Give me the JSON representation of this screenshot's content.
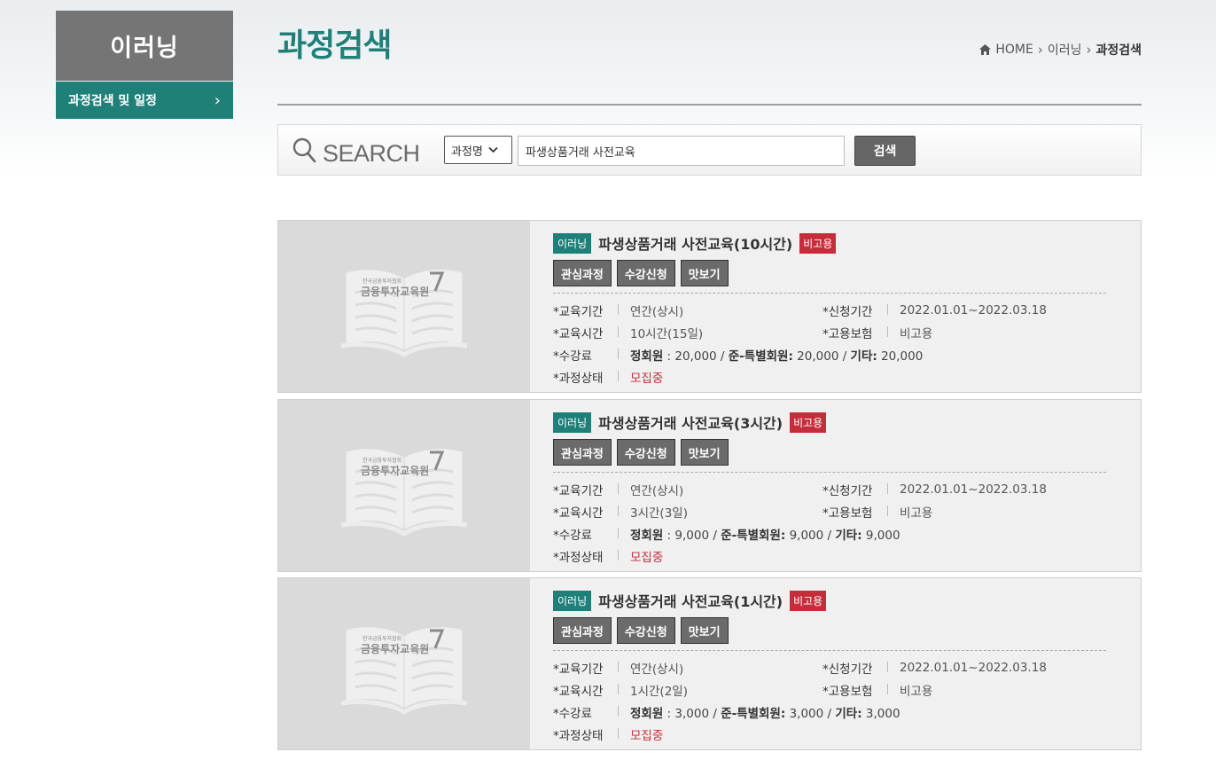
{
  "sidebar": {
    "title": "이러닝",
    "items": [
      {
        "label": "과정검색 및 일정"
      }
    ]
  },
  "header": {
    "title": "과정검색",
    "breadcrumb": [
      "HOME",
      "이러닝",
      "과정검색"
    ]
  },
  "search": {
    "label": "SEARCH",
    "select_value": "과정명",
    "query": "파생상품거래 사전교육",
    "button": "검색"
  },
  "labels": {
    "period": "교육기간",
    "apply": "신청기간",
    "hours": "교육시간",
    "insurance": "고용보험",
    "fee": "수강료",
    "status": "과정상태",
    "fee_regular": "정회원",
    "fee_special": "준-특별회원:",
    "fee_other": "기타:"
  },
  "buttons": {
    "interest": "관심과정",
    "enroll": "수강신청",
    "preview": "맛보기"
  },
  "thumb_logo": {
    "small": "한국금융투자협회",
    "main": "금융투자교육원"
  },
  "courses": [
    {
      "category": "이러닝",
      "title": "파생상품거래 사전교육(10시간)",
      "badge": "비고용",
      "period": "연간(상시)",
      "apply": "2022.01.01~2022.03.18",
      "hours": "10시간(15일)",
      "insurance": "비고용",
      "fee_regular": " : 20,000 / ",
      "fee_special": " 20,000 / ",
      "fee_other": " 20,000",
      "status": "모집중"
    },
    {
      "category": "이러닝",
      "title": "파생상품거래 사전교육(3시간)",
      "badge": "비고용",
      "period": "연간(상시)",
      "apply": "2022.01.01~2022.03.18",
      "hours": "3시간(3일)",
      "insurance": "비고용",
      "fee_regular": " : 9,000 / ",
      "fee_special": " 9,000 / ",
      "fee_other": " 9,000",
      "status": "모집중"
    },
    {
      "category": "이러닝",
      "title": "파생상품거래 사전교육(1시간)",
      "badge": "비고용",
      "period": "연간(상시)",
      "apply": "2022.01.01~2022.03.18",
      "hours": "1시간(2일)",
      "insurance": "비고용",
      "fee_regular": " : 3,000 / ",
      "fee_special": " 3,000 / ",
      "fee_other": " 3,000",
      "status": "모집중"
    }
  ],
  "colors": {
    "accent": "#1f807a",
    "sidebar_title_bg": "#757575",
    "badge_red": "#c62d3a",
    "button_gray": "#6b6b6b"
  },
  "icons": {
    "home": "home-icon",
    "search": "magnifier-icon",
    "chevron": "chevron-right-icon",
    "book": "open-book-icon"
  }
}
